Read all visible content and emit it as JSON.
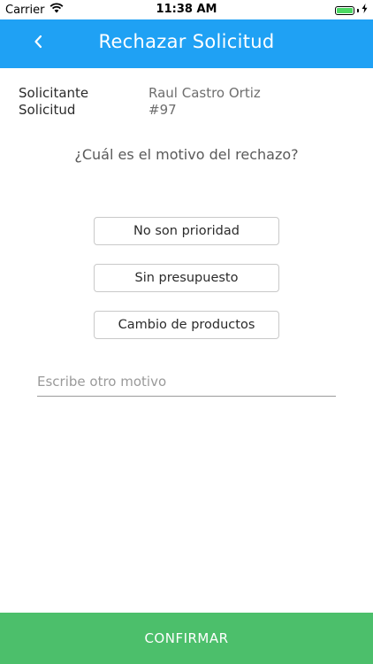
{
  "status_bar": {
    "carrier": "Carrier",
    "time": "11:38 AM",
    "wifi_icon": "wifi-icon",
    "battery_icon": "battery-icon",
    "charging_icon": "bolt-icon"
  },
  "header": {
    "title": "Rechazar Solicitud",
    "back_icon": "chevron-left-icon",
    "background_color": "#1fa1f4"
  },
  "info": {
    "requester_label": "Solicitante",
    "requester_value": "Raul Castro Ortiz",
    "request_label": "Solicitud",
    "request_value": "#97"
  },
  "question": "¿Cuál es el motivo del rechazo?",
  "reasons": [
    {
      "label": "No son prioridad"
    },
    {
      "label": "Sin presupuesto"
    },
    {
      "label": "Cambio de productos"
    }
  ],
  "other_reason": {
    "placeholder": "Escribe otro motivo",
    "value": ""
  },
  "confirm": {
    "label": "CONFIRMAR",
    "background_color": "#4cbf6b"
  }
}
